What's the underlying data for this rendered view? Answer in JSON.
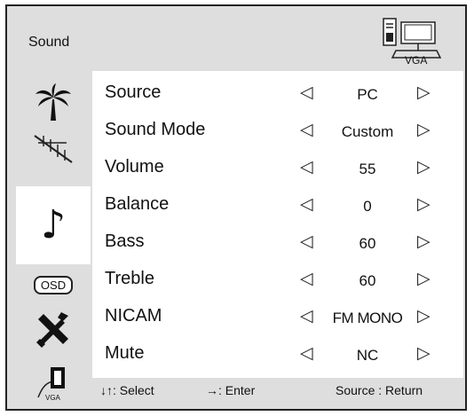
{
  "header": {
    "title": "Sound",
    "source_label": "VGA"
  },
  "side_icons": [
    {
      "name": "picture-icon"
    },
    {
      "name": "antenna-icon"
    },
    {
      "name": "music-note-icon",
      "glyph": "♪"
    },
    {
      "name": "osd-icon",
      "label": "OSD"
    },
    {
      "name": "tools-icon"
    },
    {
      "name": "vga-connector-icon",
      "label": "VGA"
    }
  ],
  "rows": [
    {
      "label": "Source",
      "value": "PC"
    },
    {
      "label": "Sound Mode",
      "value": "Custom"
    },
    {
      "label": "Volume",
      "value": "55"
    },
    {
      "label": "Balance",
      "value": "0"
    },
    {
      "label": "Bass",
      "value": "60"
    },
    {
      "label": "Treble",
      "value": "60"
    },
    {
      "label": "NICAM",
      "value": "FM MONO"
    },
    {
      "label": "Mute",
      "value": "NC"
    }
  ],
  "arrows": {
    "left": "◁",
    "right": "▷"
  },
  "footer": {
    "select": "↓↑: Select",
    "enter": "→: Enter",
    "return": "Source : Return"
  }
}
